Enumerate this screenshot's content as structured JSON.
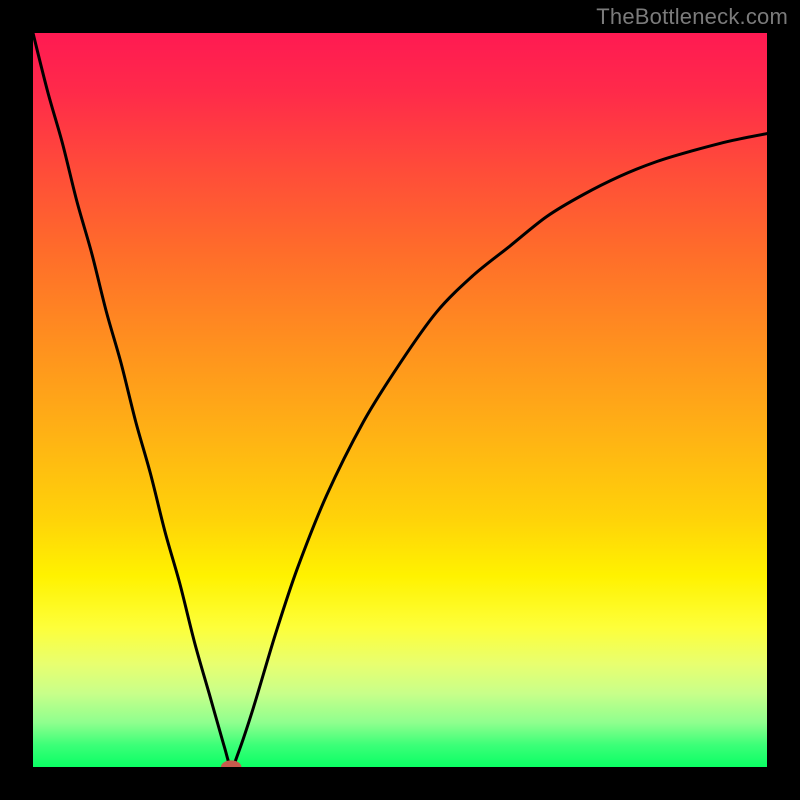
{
  "watermark": "TheBottleneck.com",
  "chart_data": {
    "type": "line",
    "title": "",
    "xlabel": "",
    "ylabel": "",
    "xlim": [
      0,
      100
    ],
    "ylim": [
      0,
      100
    ],
    "grid": false,
    "legend": false,
    "series": [
      {
        "name": "curve",
        "color": "#000000",
        "x": [
          0,
          2,
          4,
          6,
          8,
          10,
          12,
          14,
          16,
          18,
          20,
          22,
          24,
          26,
          27,
          28,
          30,
          33,
          36,
          40,
          45,
          50,
          55,
          60,
          65,
          70,
          75,
          80,
          85,
          90,
          95,
          100
        ],
        "y": [
          100,
          92,
          85,
          77,
          70,
          62,
          55,
          47,
          40,
          32,
          25,
          17,
          10,
          3,
          0,
          2,
          8,
          18,
          27,
          37,
          47,
          55,
          62,
          67,
          71,
          75,
          78,
          80.5,
          82.5,
          84,
          85.3,
          86.3
        ]
      }
    ],
    "marker": {
      "x": 27,
      "y": 0,
      "rx": 1.4,
      "ry": 0.9,
      "color": "#c75b4d"
    },
    "gradient_stops": [
      {
        "pct": 0,
        "color": "#ff1a52"
      },
      {
        "pct": 18,
        "color": "#ff4a3a"
      },
      {
        "pct": 42,
        "color": "#ff8f1f"
      },
      {
        "pct": 66,
        "color": "#ffd209"
      },
      {
        "pct": 81,
        "color": "#fdff3a"
      },
      {
        "pct": 94,
        "color": "#8eff8e"
      },
      {
        "pct": 100,
        "color": "#0aff64"
      }
    ]
  }
}
